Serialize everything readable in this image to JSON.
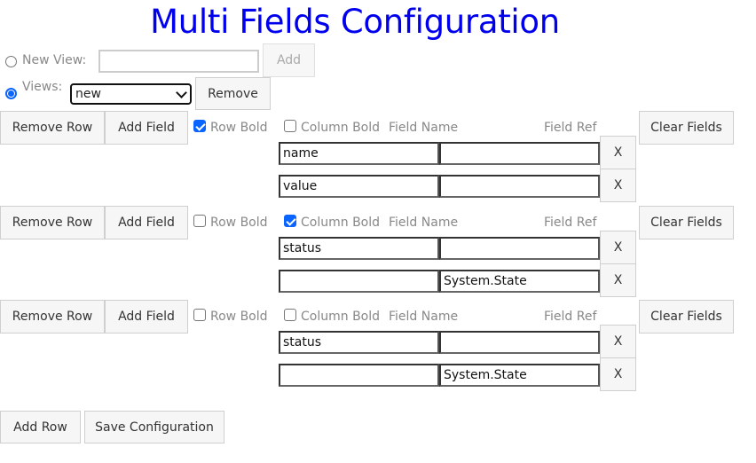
{
  "title": "Multi Fields Configuration",
  "view_controls": {
    "new_view": {
      "label": "New View:",
      "selected": false,
      "input_value": "",
      "add_label": "Add"
    },
    "views": {
      "label": "Views:",
      "selected": true,
      "selected_value": "new",
      "remove_label": "Remove"
    }
  },
  "row_labels": {
    "remove_row": "Remove Row",
    "add_field": "Add Field",
    "row_bold": "Row Bold",
    "column_bold": "Column Bold",
    "field_name": "Field Name",
    "field_ref": "Field Ref",
    "clear_fields": "Clear Fields",
    "remove_field": "X"
  },
  "rows": [
    {
      "row_bold": true,
      "column_bold": false,
      "fields": [
        {
          "name": "name",
          "ref": ""
        },
        {
          "name": "value",
          "ref": ""
        }
      ]
    },
    {
      "row_bold": false,
      "column_bold": true,
      "fields": [
        {
          "name": "status",
          "ref": ""
        },
        {
          "name": "",
          "ref": "System.State"
        }
      ]
    },
    {
      "row_bold": false,
      "column_bold": false,
      "fields": [
        {
          "name": "status",
          "ref": ""
        },
        {
          "name": "",
          "ref": "System.State"
        }
      ]
    }
  ],
  "footer": {
    "add_row": "Add Row",
    "save_configuration": "Save Configuration"
  }
}
